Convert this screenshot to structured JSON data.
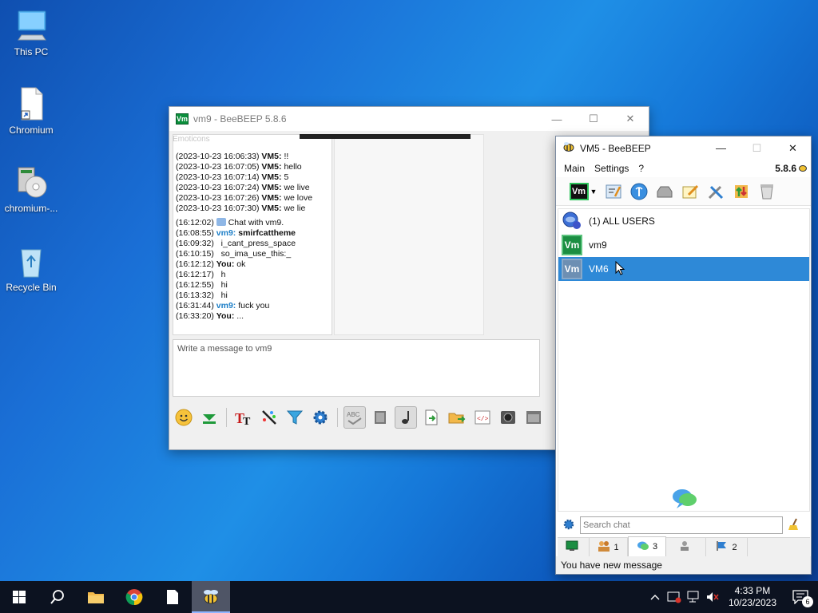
{
  "desktop": {
    "icons": [
      {
        "label": "This PC",
        "icon": "this-pc-icon"
      },
      {
        "label": "Chromium",
        "icon": "file-shortcut-icon"
      },
      {
        "label": "chromium-...",
        "icon": "installer-icon"
      },
      {
        "label": "Recycle Bin",
        "icon": "recycle-bin-icon"
      }
    ]
  },
  "chat_window": {
    "title": "vm9 - BeeBEEP 5.8.6",
    "app_badge": "Vm",
    "ghost_label": "Emoticons",
    "log": [
      {
        "time": "(2023-10-23 16:06:33)",
        "sender": "VM5:",
        "text": "!!"
      },
      {
        "time": "(2023-10-23 16:07:05)",
        "sender": "VM5:",
        "text": "hello"
      },
      {
        "time": "(2023-10-23 16:07:14)",
        "sender": "VM5:",
        "text": "5"
      },
      {
        "time": "(2023-10-23 16:07:24)",
        "sender": "VM5:",
        "text": "we live"
      },
      {
        "time": "(2023-10-23 16:07:26)",
        "sender": "VM5:",
        "text": "we love"
      },
      {
        "time": "(2023-10-23 16:07:30)",
        "sender": "VM5:",
        "text": "we lie"
      },
      {
        "time": "(16:12:02)",
        "sender": "",
        "text": "Chat with vm9."
      },
      {
        "time": "(16:08:55)",
        "sender": "vm9:",
        "text": "smirfcattheme"
      },
      {
        "time": "(16:09:32)",
        "sender": "",
        "text": "i_cant_press_space"
      },
      {
        "time": "(16:10:15)",
        "sender": "",
        "text": "so_ima_use_this:_"
      },
      {
        "time": "(16:12:12)",
        "sender": "You:",
        "text": "ok"
      },
      {
        "time": "(16:12:17)",
        "sender": "",
        "text": "h"
      },
      {
        "time": "(16:12:55)",
        "sender": "",
        "text": "hi"
      },
      {
        "time": "(16:13:32)",
        "sender": "",
        "text": "hi"
      },
      {
        "time": "(16:31:44)",
        "sender": "vm9:",
        "text": "fuck you"
      },
      {
        "time": "(16:33:20)",
        "sender": "You:",
        "text": "..."
      }
    ],
    "composer_placeholder": "Write a message to vm9"
  },
  "main_window": {
    "title": "VM5 - BeeBEEP",
    "menu": [
      "Main",
      "Settings",
      "?"
    ],
    "version": "5.8.6",
    "status_badge": "Vm",
    "users": [
      {
        "label": "(1) ALL USERS",
        "icon": "all-users-icon"
      },
      {
        "label": "vm9",
        "badge": "Vm"
      },
      {
        "label": "VM6",
        "badge": "Vm"
      }
    ],
    "search_placeholder": "Search chat",
    "tabs": [
      {
        "icon": "monitor-icon",
        "count": ""
      },
      {
        "icon": "users-icon",
        "count": "1"
      },
      {
        "icon": "chat-icon",
        "count": "3"
      },
      {
        "icon": "groups-icon",
        "count": ""
      },
      {
        "icon": "flag-icon",
        "count": "2"
      }
    ],
    "status": "You have new message"
  },
  "taskbar": {
    "clock_time": "4:33 PM",
    "clock_date": "10/23/2023",
    "notification_count": "6"
  },
  "colors": {
    "desktop_blue": "#1a7ad8",
    "selection": "#2e89d7",
    "vm_green": "#1b8e42",
    "taskbar": "#0c1220"
  }
}
